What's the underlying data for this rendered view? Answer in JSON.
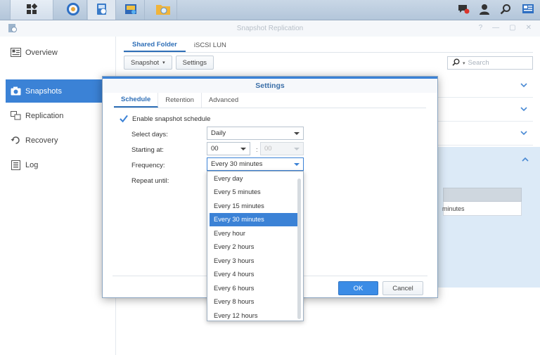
{
  "taskbar": {
    "icons": [
      "main-menu-icon",
      "dashboard-icon",
      "snapshot-replication-app-icon",
      "media-app-icon",
      "file-station-icon"
    ],
    "right_icons": [
      "chat-icon",
      "user-icon",
      "search-icon",
      "widgets-icon"
    ]
  },
  "window": {
    "title": "Snapshot Replication",
    "controls": [
      "?",
      "—",
      "▢",
      "✕"
    ]
  },
  "sidebar": {
    "items": [
      {
        "label": "Overview",
        "icon": "overview-icon"
      },
      {
        "label": "Snapshots",
        "icon": "camera-icon",
        "active": true
      },
      {
        "label": "Replication",
        "icon": "replication-icon"
      },
      {
        "label": "Recovery",
        "icon": "recovery-icon"
      },
      {
        "label": "Log",
        "icon": "log-icon"
      }
    ]
  },
  "main": {
    "tabs": [
      {
        "label": "Shared Folder",
        "active": true
      },
      {
        "label": "iSCSI LUN"
      }
    ],
    "toolbar": {
      "snapshot_label": "Snapshot",
      "settings_label": "Settings"
    },
    "search": {
      "placeholder": "Search"
    },
    "background_cell": "minutes"
  },
  "dialog": {
    "title": "Settings",
    "tabs": [
      {
        "label": "Schedule",
        "active": true
      },
      {
        "label": "Retention"
      },
      {
        "label": "Advanced"
      }
    ],
    "enable_label": "Enable snapshot schedule",
    "enabled": true,
    "select_days_label": "Select days:",
    "select_days_value": "Daily",
    "starting_at_label": "Starting at:",
    "starting_hour": "00",
    "starting_minute": "00",
    "frequency_label": "Frequency:",
    "frequency_value": "Every 30 minutes",
    "repeat_until_label": "Repeat until:",
    "ok_label": "OK",
    "cancel_label": "Cancel"
  },
  "frequency_options": [
    "Every day",
    "Every 5 minutes",
    "Every 15 minutes",
    "Every 30 minutes",
    "Every hour",
    "Every 2 hours",
    "Every 3 hours",
    "Every 4 hours",
    "Every 6 hours",
    "Every 8 hours",
    "Every 12 hours"
  ],
  "frequency_selected_index": 3,
  "colors": {
    "accent": "#3b82d6",
    "taskbar": "#c3d2e2",
    "expanded_row": "#dceaf7"
  }
}
